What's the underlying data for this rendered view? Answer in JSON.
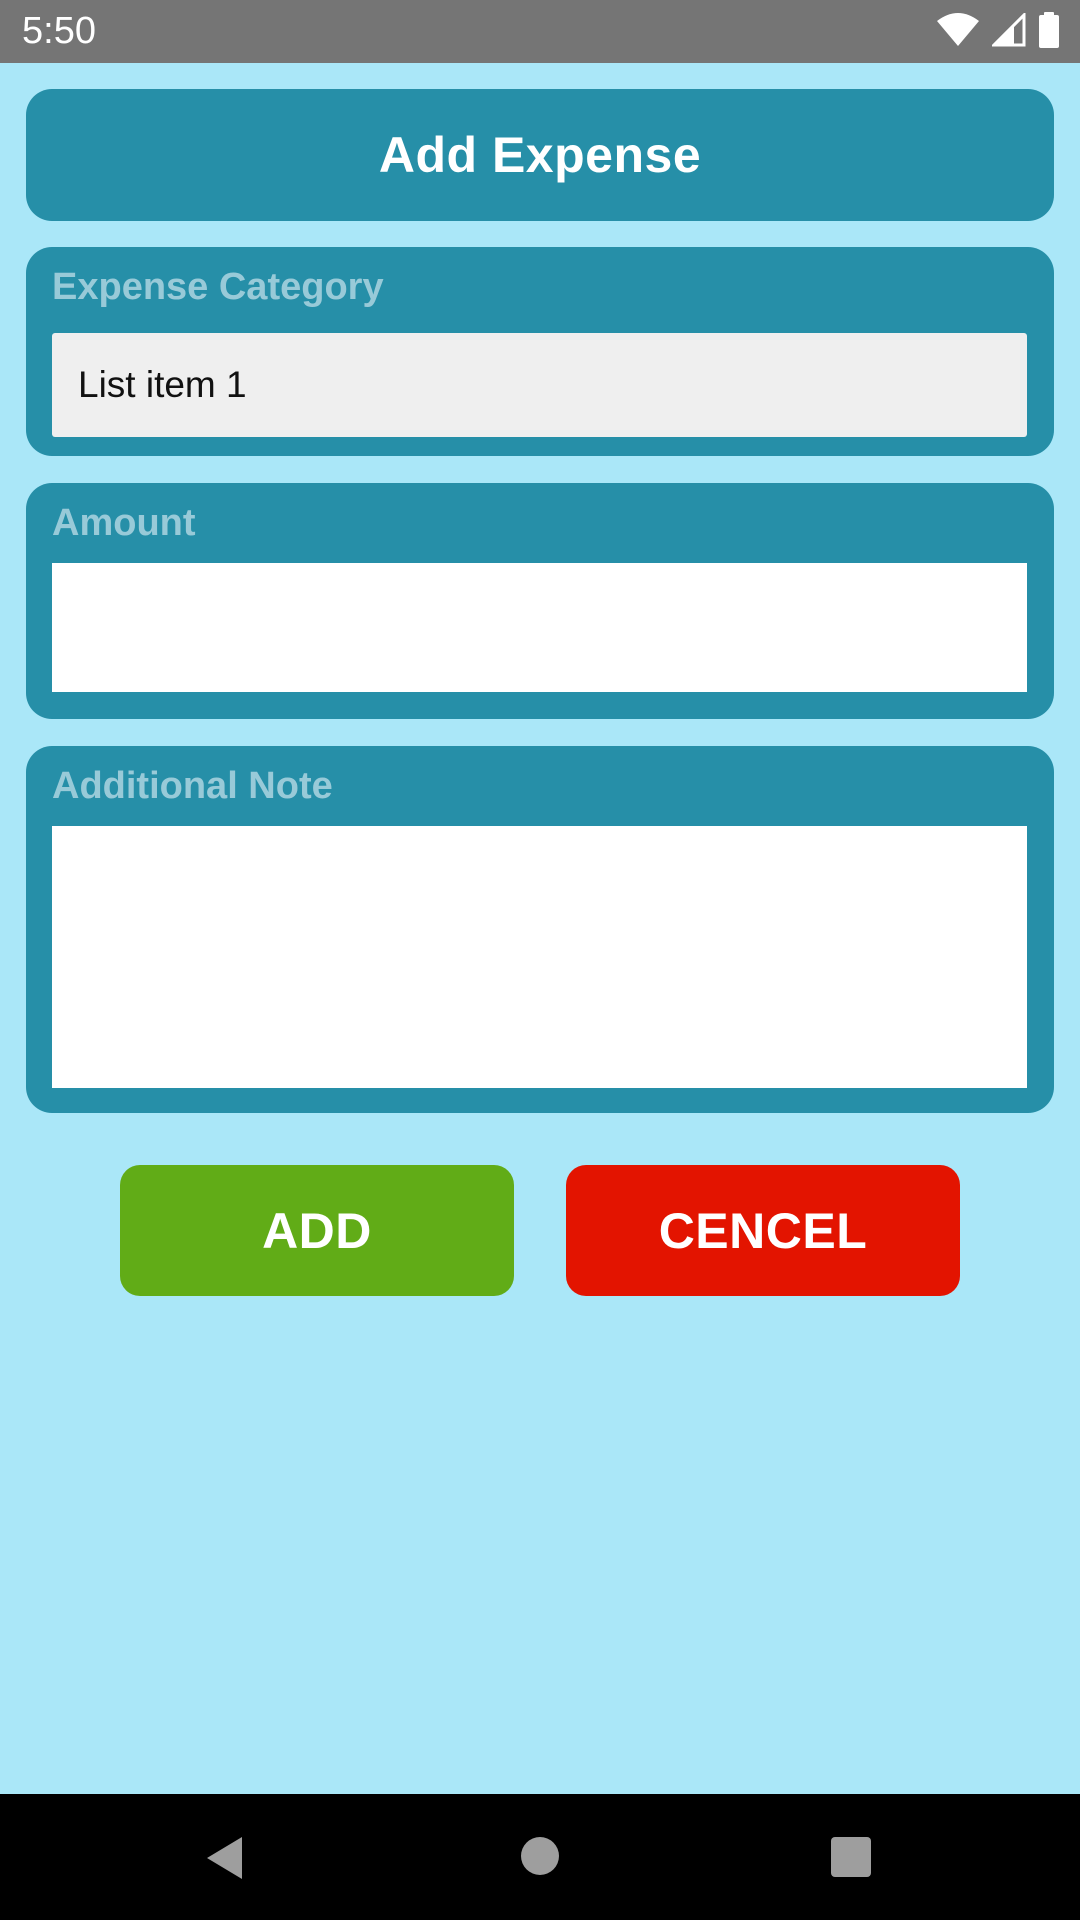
{
  "status_bar": {
    "time": "5:50",
    "icons": [
      "wifi-icon",
      "cellular-signal-icon",
      "battery-icon"
    ]
  },
  "header": {
    "title": "Add Expense"
  },
  "form": {
    "category": {
      "label": "Expense Category",
      "selected_value": "List item 1"
    },
    "amount": {
      "label": "Amount",
      "value": ""
    },
    "note": {
      "label": "Additional Note",
      "value": ""
    }
  },
  "actions": {
    "add_label": "ADD",
    "cancel_label": "CENCEL"
  },
  "nav_bar": {
    "icons": [
      "back-icon",
      "home-icon",
      "recents-icon"
    ]
  },
  "colors": {
    "background": "#aae7f8",
    "card": "#268fa8",
    "label": "#98cad8",
    "add_button": "#61ac17",
    "cancel_button": "#e31400",
    "status_bar": "#757575"
  }
}
